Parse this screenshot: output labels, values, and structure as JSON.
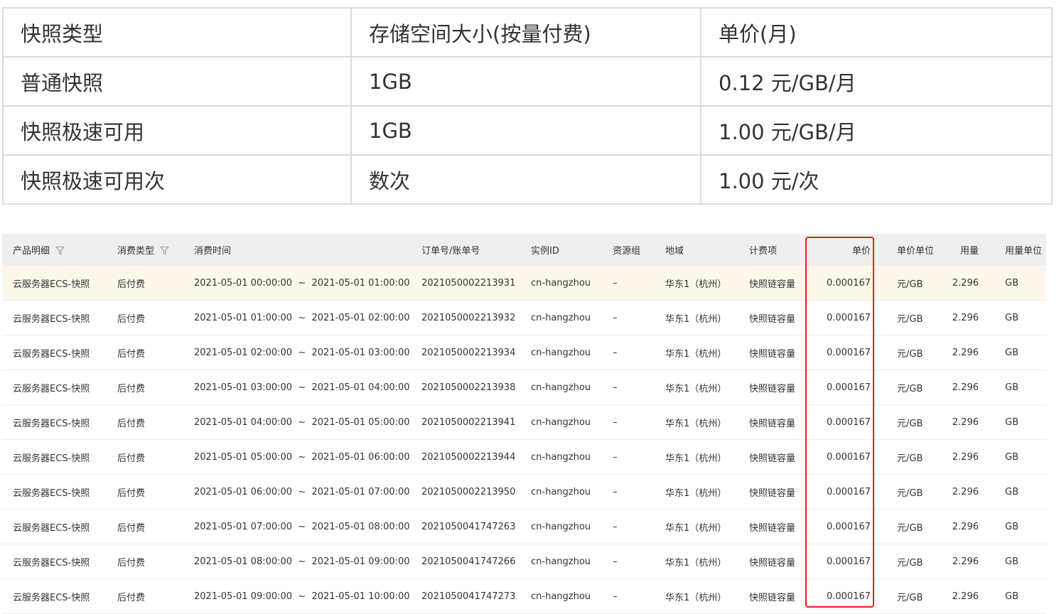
{
  "price_table": {
    "header": [
      "快照类型",
      "存储空间大小(按量付费)",
      "单价(月)"
    ],
    "rows": [
      [
        "普通快照",
        "1GB",
        "0.12 元/GB/月"
      ],
      [
        "快照极速可用",
        "1GB",
        "1.00 元/GB/月"
      ],
      [
        "快照极速可用次",
        "数次",
        "1.00 元/次"
      ]
    ]
  },
  "bill_table": {
    "columns": [
      "产品明细",
      "消费类型",
      "消费时间",
      "订单号/账单号",
      "实例ID",
      "资源组",
      "地域",
      "计费项",
      "单价",
      "单价单位",
      "用量",
      "用量单位"
    ],
    "filter_icon": "filter-funnel-icon",
    "rows": [
      [
        "云服务器ECS-快照",
        "后付费",
        "2021-05-01 00:00:00  ~  2021-05-01 01:00:00",
        "2021050002213931",
        "cn-hangzhou",
        "–",
        "华东1（杭州）",
        "快照链容量",
        "0.000167",
        "元/GB",
        "2.296",
        "GB"
      ],
      [
        "云服务器ECS-快照",
        "后付费",
        "2021-05-01 01:00:00  ~  2021-05-01 02:00:00",
        "2021050002213932",
        "cn-hangzhou",
        "–",
        "华东1（杭州）",
        "快照链容量",
        "0.000167",
        "元/GB",
        "2.296",
        "GB"
      ],
      [
        "云服务器ECS-快照",
        "后付费",
        "2021-05-01 02:00:00  ~  2021-05-01 03:00:00",
        "2021050002213934",
        "cn-hangzhou",
        "–",
        "华东1（杭州）",
        "快照链容量",
        "0.000167",
        "元/GB",
        "2.296",
        "GB"
      ],
      [
        "云服务器ECS-快照",
        "后付费",
        "2021-05-01 03:00:00  ~  2021-05-01 04:00:00",
        "2021050002213938",
        "cn-hangzhou",
        "–",
        "华东1（杭州）",
        "快照链容量",
        "0.000167",
        "元/GB",
        "2.296",
        "GB"
      ],
      [
        "云服务器ECS-快照",
        "后付费",
        "2021-05-01 04:00:00  ~  2021-05-01 05:00:00",
        "2021050002213941",
        "cn-hangzhou",
        "–",
        "华东1（杭州）",
        "快照链容量",
        "0.000167",
        "元/GB",
        "2.296",
        "GB"
      ],
      [
        "云服务器ECS-快照",
        "后付费",
        "2021-05-01 05:00:00  ~  2021-05-01 06:00:00",
        "2021050002213944",
        "cn-hangzhou",
        "–",
        "华东1（杭州）",
        "快照链容量",
        "0.000167",
        "元/GB",
        "2.296",
        "GB"
      ],
      [
        "云服务器ECS-快照",
        "后付费",
        "2021-05-01 06:00:00  ~  2021-05-01 07:00:00",
        "2021050002213950",
        "cn-hangzhou",
        "–",
        "华东1（杭州）",
        "快照链容量",
        "0.000167",
        "元/GB",
        "2.296",
        "GB"
      ],
      [
        "云服务器ECS-快照",
        "后付费",
        "2021-05-01 07:00:00  ~  2021-05-01 08:00:00",
        "2021050041747263",
        "cn-hangzhou",
        "–",
        "华东1（杭州）",
        "快照链容量",
        "0.000167",
        "元/GB",
        "2.296",
        "GB"
      ],
      [
        "云服务器ECS-快照",
        "后付费",
        "2021-05-01 08:00:00  ~  2021-05-01 09:00:00",
        "2021050041747266",
        "cn-hangzhou",
        "–",
        "华东1（杭州）",
        "快照链容量",
        "0.000167",
        "元/GB",
        "2.296",
        "GB"
      ],
      [
        "云服务器ECS-快照",
        "后付费",
        "2021-05-01 09:00:00  ~  2021-05-01 10:00:00",
        "2021050041747273",
        "cn-hangzhou",
        "–",
        "华东1（杭州）",
        "快照链容量",
        "0.000167",
        "元/GB",
        "2.296",
        "GB"
      ]
    ]
  },
  "colors": {
    "highlight_row": "#fdf8ea",
    "header_bg": "#efefef",
    "annotation_box": "#e02020"
  }
}
